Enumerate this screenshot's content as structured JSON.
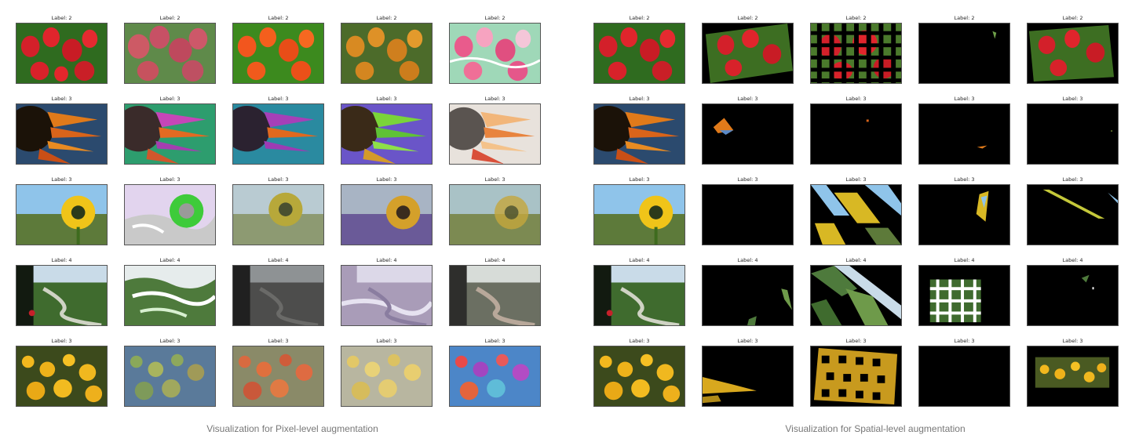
{
  "left": {
    "caption": "Visualization for Pixel-level augmentation",
    "rows": [
      [
        "Label: 2",
        "Label: 2",
        "Label: 2",
        "Label: 2",
        "Label: 2"
      ],
      [
        "Label: 3",
        "Label: 3",
        "Label: 3",
        "Label: 3",
        "Label: 3"
      ],
      [
        "Label: 3",
        "Label: 3",
        "Label: 3",
        "Label: 3",
        "Label: 3"
      ],
      [
        "Label: 4",
        "Label: 4",
        "Label: 4",
        "Label: 4",
        "Label: 4"
      ],
      [
        "Label: 3",
        "Label: 3",
        "Label: 3",
        "Label: 3",
        "Label: 3"
      ]
    ]
  },
  "right": {
    "caption": "Visualization for Spatial-level augmentation",
    "rows": [
      [
        "Label: 2",
        "Label: 2",
        "Label: 2",
        "Label: 2",
        "Label: 2"
      ],
      [
        "Label: 3",
        "Label: 3",
        "Label: 3",
        "Label: 3",
        "Label: 3"
      ],
      [
        "Label: 3",
        "Label: 3",
        "Label: 3",
        "Label: 3",
        "Label: 3"
      ],
      [
        "Label: 4",
        "Label: 4",
        "Label: 4",
        "Label: 4",
        "Label: 4"
      ],
      [
        "Label: 3",
        "Label: 3",
        "Label: 3",
        "Label: 3",
        "Label: 3"
      ]
    ]
  }
}
